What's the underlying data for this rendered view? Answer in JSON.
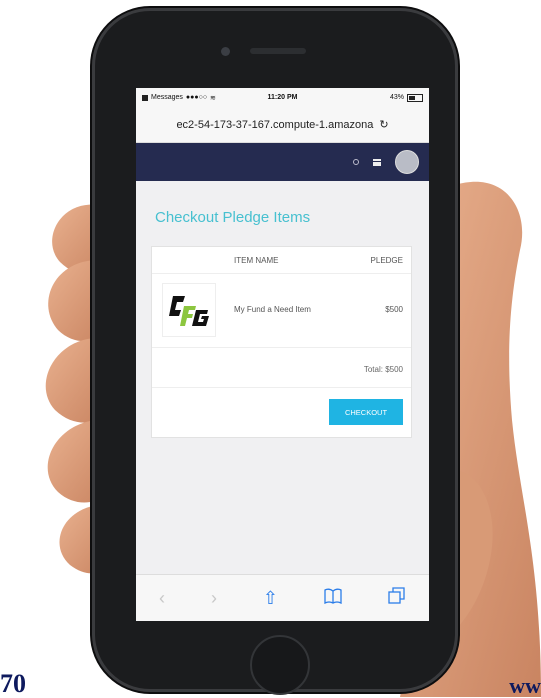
{
  "status_bar": {
    "carrier": "Messages",
    "signal": "●●●○○",
    "time": "11:20 PM",
    "battery": "43%"
  },
  "browser": {
    "url": "ec2-54-173-37-167.compute-1.amazona",
    "reload_icon": "reload-icon"
  },
  "app_nav": {
    "icons": [
      "settings-icon",
      "list-icon",
      "avatar"
    ],
    "nav_color": "#252b50"
  },
  "page": {
    "title": "Checkout Pledge Items",
    "title_color": "#47c0d0",
    "table": {
      "columns": [
        "ITEM NAME",
        "PLEDGE"
      ],
      "rows": [
        {
          "logo": "CFG",
          "name": "My Fund a Need Item",
          "pledge": "$500"
        }
      ],
      "total": "Total: $500"
    },
    "checkout_label": "CHECKOUT",
    "checkout_color": "#1fb4e3"
  },
  "toolbar": {
    "items": [
      {
        "name": "back",
        "glyph": "‹"
      },
      {
        "name": "forward",
        "glyph": "›"
      },
      {
        "name": "share",
        "glyph": "⇧"
      },
      {
        "name": "bookmarks",
        "glyph": "📖"
      },
      {
        "name": "tabs",
        "glyph": "⧉"
      }
    ]
  },
  "corners": {
    "left_text": "70",
    "right_text": "ww"
  }
}
